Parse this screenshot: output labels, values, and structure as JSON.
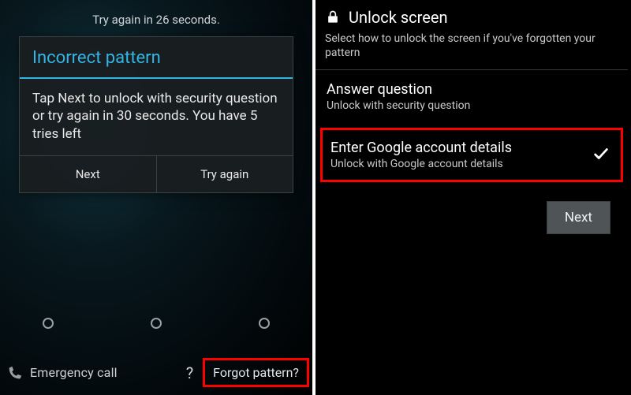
{
  "left": {
    "countdown": "Try again in 26 seconds.",
    "dialog": {
      "title": "Incorrect pattern",
      "body": "Tap Next to unlock with security question or try again in 30 seconds. You have 5 tries left",
      "next_label": "Next",
      "try_again_label": "Try again"
    },
    "bottom": {
      "emergency_label": "Emergency call",
      "forgot_label": "Forgot pattern?"
    }
  },
  "right": {
    "title": "Unlock screen",
    "subtitle": "Select how to unlock the screen if you've forgotten your pattern",
    "options": [
      {
        "title": "Answer question",
        "sub": "Unlock with security question",
        "selected": false
      },
      {
        "title": "Enter Google account details",
        "sub": "Unlock with Google account details",
        "selected": true
      }
    ],
    "next_label": "Next"
  }
}
